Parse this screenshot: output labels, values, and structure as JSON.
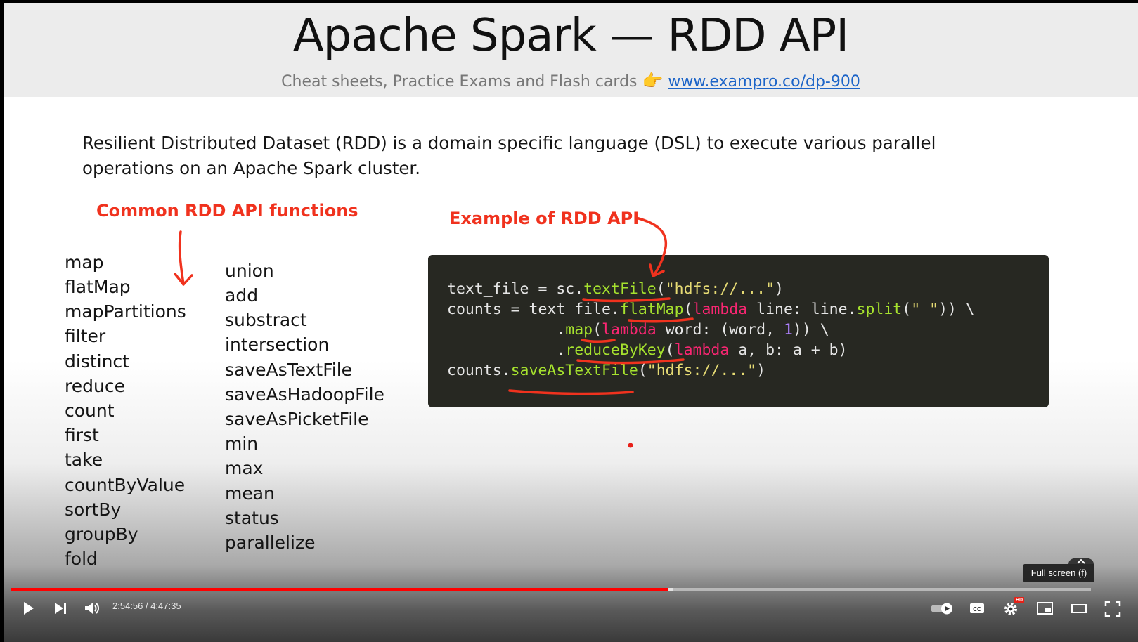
{
  "slide": {
    "title": "Apache Spark — RDD API",
    "subtitle_text": "Cheat sheets, Practice Exams and Flash cards",
    "subtitle_link": "www.exampro.co/dp-900",
    "description": "Resilient Distributed Dataset (RDD) is a domain specific language (DSL) to execute  various parallel operations on an Apache Spark cluster.",
    "functions_heading": "Common RDD API functions",
    "example_heading": "Example of RDD API",
    "functions_col1": [
      "map",
      "flatMap",
      "mapPartitions",
      "filter",
      "distinct",
      "reduce",
      "count",
      "first",
      "take",
      "countByValue",
      "sortBy",
      "groupBy",
      "fold"
    ],
    "functions_col2": [
      "union",
      "add",
      "substract",
      "intersection",
      "saveAsTextFile",
      "saveAsHadoopFile",
      "saveAsPicketFile",
      "min",
      "max",
      "mean",
      "status",
      "parallelize"
    ],
    "code": {
      "l1": {
        "a": "text_file = sc.",
        "fn": "textFile",
        "b": "(",
        "s": "\"hdfs://...\"",
        "c": ")"
      },
      "l2": {
        "a": "counts = text_file.",
        "fn": "flatMap",
        "b": "(",
        "kw": "lambda",
        "c": " line: line.",
        "fn2": "split",
        "d": "(",
        "s": "\" \"",
        "e": ")) \\"
      },
      "l3": {
        "a": "            .",
        "fn": "map",
        "b": "(",
        "kw": "lambda",
        "c": " word: (word, ",
        "num": "1",
        "d": ")) \\"
      },
      "l4": {
        "a": "            .",
        "fn": "reduceByKey",
        "b": "(",
        "kw": "lambda",
        "c": " a, b: a + b)"
      },
      "l5": {
        "a": "counts.",
        "fn": "saveAsTextFile",
        "b": "(",
        "s": "\"hdfs://...\"",
        "c": ")"
      }
    },
    "accent_color": "#f0321e"
  },
  "player": {
    "current_time": "2:54:56",
    "separator": " / ",
    "duration": "4:47:35",
    "progress_fraction": 0.6085,
    "buffered_fraction": 0.6135,
    "tooltip": "Full screen (f)",
    "hd_badge": "HD",
    "icons": [
      "play-icon",
      "next-icon",
      "volume-icon",
      "autoplay-toggle-icon",
      "captions-icon",
      "settings-icon",
      "miniplayer-icon",
      "theater-icon",
      "fullscreen-icon"
    ]
  }
}
